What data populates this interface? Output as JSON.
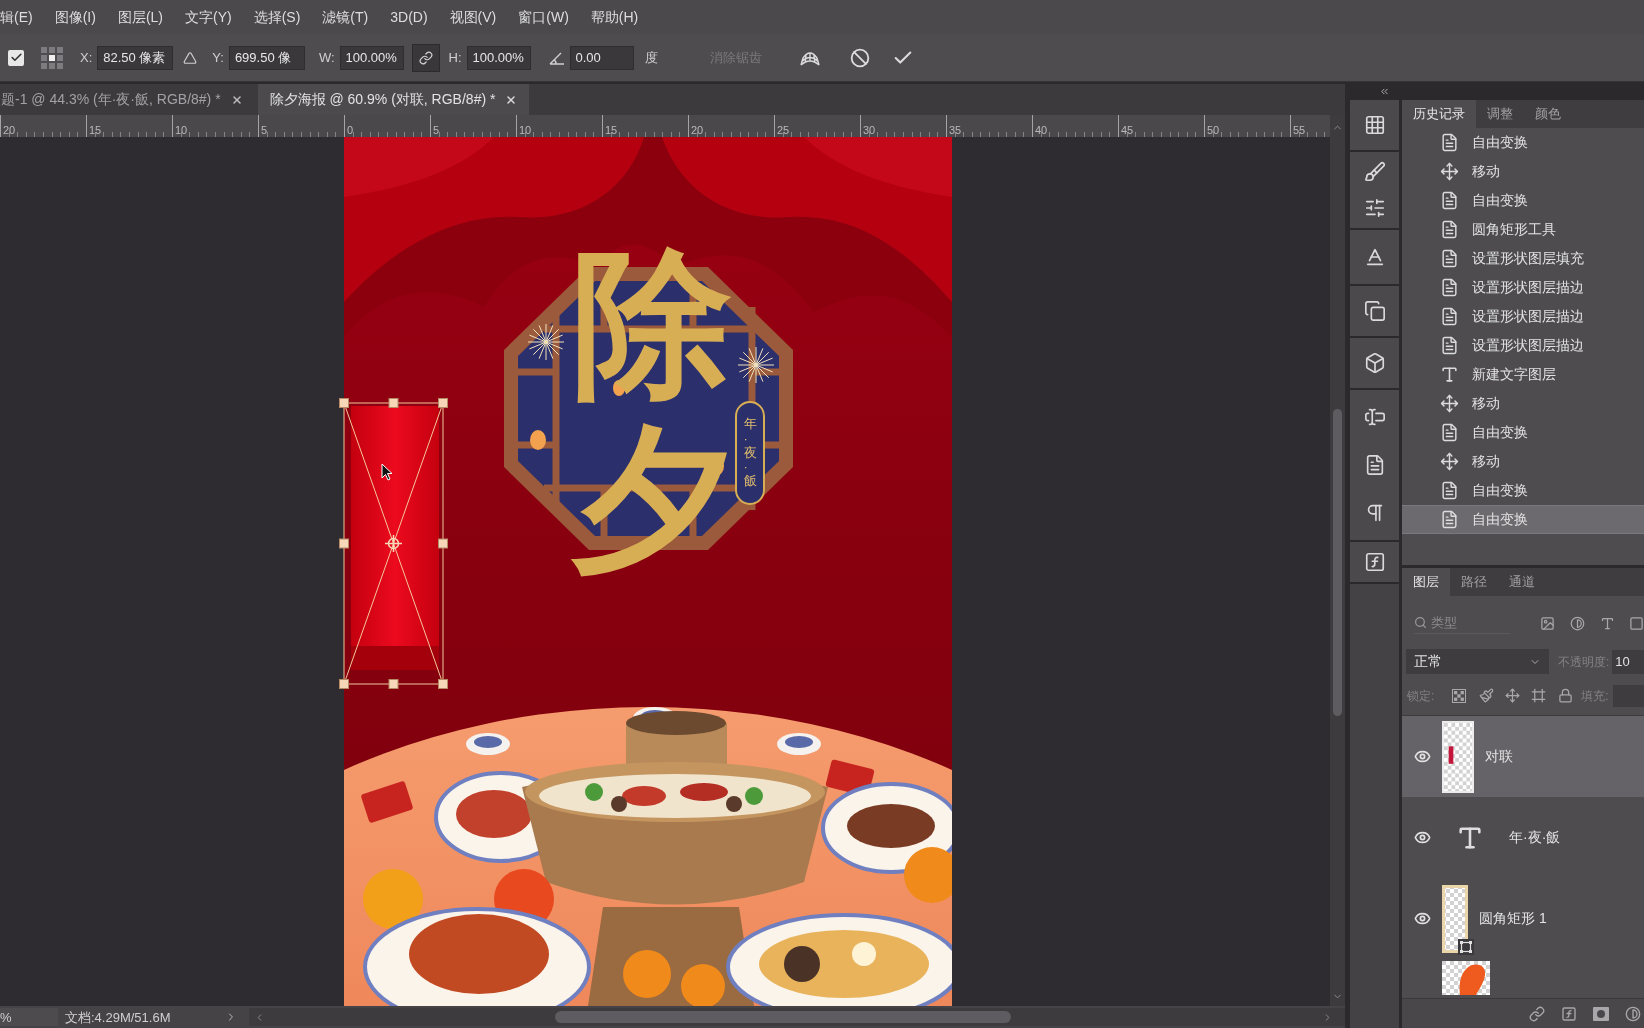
{
  "menu_bar": {
    "items": [
      "辑(E)",
      "图像(I)",
      "图层(L)",
      "文字(Y)",
      "选择(S)",
      "滤镜(T)",
      "3D(D)",
      "视图(V)",
      "窗口(W)",
      "帮助(H)"
    ]
  },
  "options_bar": {
    "reference_point_checked": true,
    "x_label": "X:",
    "x_value": "82.50 像素",
    "y_label": "Y:",
    "y_value": "699.50 像",
    "w_label": "W:",
    "w_value": "100.00%",
    "link_selected": true,
    "h_label": "H:",
    "h_value": "100.00%",
    "angle_value": "0.00",
    "angle_unit": "度",
    "anti_alias": {
      "label": "消除锯齿",
      "disabled": true
    }
  },
  "document_tabs": [
    {
      "title": "题-1 @ 44.3% (年·夜·飯, RGB/8#) *",
      "selected": false
    },
    {
      "title": "除夕海报 @ 60.9% (对联, RGB/8#) *",
      "selected": true
    }
  ],
  "ruler": {
    "labels": [
      "20",
      "15",
      "10",
      "5",
      "0",
      "5",
      "10",
      "15",
      "20",
      "25",
      "30",
      "35",
      "40",
      "45",
      "50",
      "55"
    ]
  },
  "poster": {
    "title": "除夕",
    "subtitle": "年·夜·飯",
    "transform_active": true
  },
  "status_bar": {
    "zoom": "%",
    "document_info": "文档:4.29M/51.6M"
  },
  "history_panel": {
    "tabs": [
      {
        "label": "历史记录",
        "selected": true
      },
      {
        "label": "调整",
        "selected": false
      },
      {
        "label": "颜色",
        "selected": false
      }
    ],
    "items": [
      {
        "kind": "step",
        "label": "自由变换",
        "selected": false
      },
      {
        "kind": "move",
        "label": "移动",
        "selected": false
      },
      {
        "kind": "step",
        "label": "自由变换",
        "selected": false
      },
      {
        "kind": "step",
        "label": "圆角矩形工具",
        "selected": false
      },
      {
        "kind": "step",
        "label": "设置形状图层填充",
        "selected": false
      },
      {
        "kind": "step",
        "label": "设置形状图层描边",
        "selected": false
      },
      {
        "kind": "step",
        "label": "设置形状图层描边",
        "selected": false
      },
      {
        "kind": "step",
        "label": "设置形状图层描边",
        "selected": false
      },
      {
        "kind": "type",
        "label": "新建文字图层",
        "selected": false
      },
      {
        "kind": "move",
        "label": "移动",
        "selected": false
      },
      {
        "kind": "step",
        "label": "自由变换",
        "selected": false
      },
      {
        "kind": "move",
        "label": "移动",
        "selected": false
      },
      {
        "kind": "step",
        "label": "自由变换",
        "selected": false
      },
      {
        "kind": "step",
        "label": "自由变换",
        "selected": true
      }
    ]
  },
  "layers_panel": {
    "tabs": [
      {
        "label": "图层",
        "selected": true
      },
      {
        "label": "路径",
        "selected": false
      },
      {
        "label": "通道",
        "selected": false
      }
    ],
    "filter_kind": "类型",
    "blend_mode": "正常",
    "opacity_label": "不透明度:",
    "opacity_value": "10",
    "lock_label": "锁定:",
    "fill_label": "填充:",
    "items": [
      {
        "kind": "pixel",
        "name": "对联",
        "visible": true,
        "selected": true
      },
      {
        "kind": "text",
        "name": "年·夜·飯",
        "visible": true,
        "selected": false
      },
      {
        "kind": "shape",
        "name": "圆角矩形 1",
        "visible": true,
        "selected": false
      },
      {
        "kind": "image"
      }
    ]
  }
}
